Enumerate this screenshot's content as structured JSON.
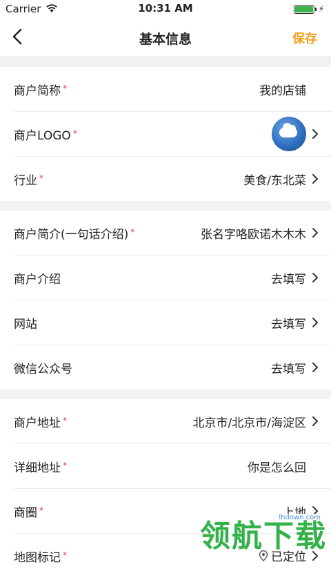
{
  "status_bar": {
    "carrier": "Carrier",
    "time": "10:31 AM",
    "battery_level": 1.0
  },
  "nav": {
    "title": "基本信息",
    "save_label": "保存",
    "back_icon": "chevron-left-icon"
  },
  "groups": [
    [
      {
        "label": "商户简称",
        "required": "*",
        "value": "我的店铺",
        "chevron": false
      },
      {
        "label": "商户LOGO",
        "required": "*",
        "value": "",
        "chevron": true,
        "image": "cloud-logo"
      },
      {
        "label": "行业",
        "required": "*",
        "value": "美食/东北菜",
        "chevron": true
      }
    ],
    [
      {
        "label": "商户简介(一句话介绍)",
        "required": "*",
        "value": "张名字咯欧诺木木木",
        "chevron": true
      },
      {
        "label": "商户介绍",
        "required": "",
        "value": "去填写",
        "chevron": true
      },
      {
        "label": "网站",
        "required": "",
        "value": "去填写",
        "chevron": true
      },
      {
        "label": "微信公众号",
        "required": "",
        "value": "去填写",
        "chevron": true
      }
    ],
    [
      {
        "label": "商户地址",
        "required": "*",
        "value": "北京市/北京市/海淀区",
        "chevron": true
      },
      {
        "label": "详细地址",
        "required": "*",
        "value": "你是怎么回",
        "chevron": false
      },
      {
        "label": "商圈",
        "required": "*",
        "value": "上地",
        "chevron": true
      },
      {
        "label": "地图标记",
        "required": "*",
        "value": "已定位",
        "chevron": true
      }
    ]
  ],
  "watermark": {
    "url": "lhdown.com",
    "text": "领航下载"
  },
  "colors": {
    "accent": "#f0a020",
    "required": "#e23a2e",
    "battery": "#3bb44a"
  }
}
